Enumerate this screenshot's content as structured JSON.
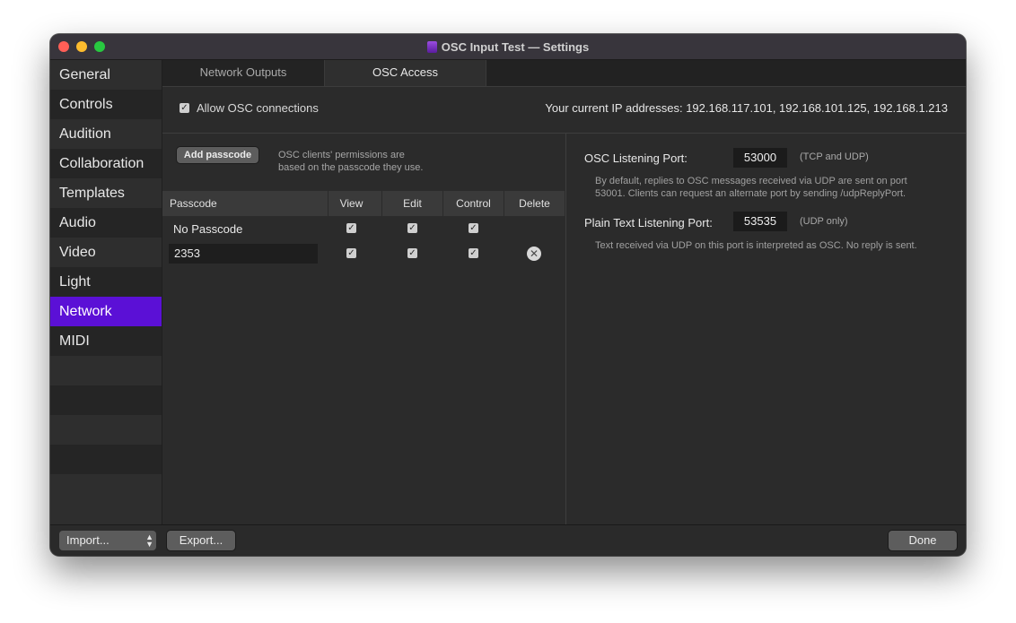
{
  "window": {
    "title": "OSC Input Test — Settings",
    "colors": {
      "accent": "#5b10d6",
      "close": "#ff5f57",
      "minimize": "#febc2e",
      "maximize": "#28c840"
    }
  },
  "sidebar": {
    "items": [
      {
        "label": "General"
      },
      {
        "label": "Controls"
      },
      {
        "label": "Audition"
      },
      {
        "label": "Collaboration"
      },
      {
        "label": "Templates"
      },
      {
        "label": "Audio"
      },
      {
        "label": "Video"
      },
      {
        "label": "Light"
      },
      {
        "label": "Network",
        "selected": true
      },
      {
        "label": "MIDI"
      }
    ]
  },
  "tabs": [
    {
      "label": "Network Outputs",
      "selected": false
    },
    {
      "label": "OSC Access",
      "selected": true
    }
  ],
  "osc_access": {
    "allow_label": "Allow OSC connections",
    "allow_checked": true,
    "ip_text": "Your current IP addresses: 192.168.117.101, 192.168.101.125, 192.168.1.213",
    "add_passcode_label": "Add passcode",
    "permission_note_line1": "OSC clients' permissions are",
    "permission_note_line2": "based on the passcode they use.",
    "columns": [
      "Passcode",
      "View",
      "Edit",
      "Control",
      "Delete"
    ],
    "rows": [
      {
        "passcode": "No Passcode",
        "view": true,
        "edit": true,
        "control": true,
        "deletable": false
      },
      {
        "passcode": "2353",
        "view": true,
        "edit": true,
        "control": true,
        "deletable": true
      }
    ],
    "osc_port_label": "OSC Listening Port:",
    "osc_port_value": "53000",
    "osc_port_hint": "(TCP and UDP)",
    "osc_port_note_line1": "By default, replies to OSC messages received via UDP are sent on port",
    "osc_port_note_line2": "53001. Clients can request an alternate port by sending /udpReplyPort.",
    "plain_port_label": "Plain Text Listening Port:",
    "plain_port_value": "53535",
    "plain_port_hint": "(UDP only)",
    "plain_port_note": "Text received via UDP on this port is interpreted as OSC. No reply is sent."
  },
  "footer": {
    "import_label": "Import...",
    "export_label": "Export...",
    "done_label": "Done"
  }
}
